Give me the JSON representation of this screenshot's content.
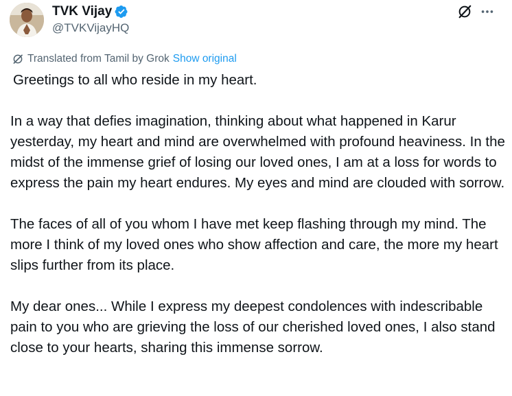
{
  "author": {
    "name": "TVK Vijay",
    "handle": "@TVKVijayHQ",
    "verified": true,
    "avatar_icon": "profile-photo",
    "verified_icon": "verified-badge-icon",
    "verified_color": "#1d9bf0"
  },
  "actions": {
    "grok_icon": "grok-icon",
    "more_icon": "more-horizontal-icon"
  },
  "translation": {
    "icon": "grok-translate-icon",
    "label": "Translated from Tamil by Grok",
    "show_original": "Show original",
    "link_color": "#1d9bf0"
  },
  "body": {
    "paragraphs": [
      "Greetings to all who reside in my heart.",
      "In a way that defies imagination, thinking about what happened in Karur yesterday, my heart and mind are overwhelmed with profound heaviness. In the midst of the immense grief of losing our loved ones, I am at a loss for words to express the pain my heart endures. My eyes and mind are clouded with sorrow.",
      "The faces of all of you whom I have met keep flashing through my mind. The more I think of my loved ones who show affection and care, the more my heart slips further from its place.",
      "My dear ones... While I express my deepest condolences with indescribable pain to you who are grieving the loss of our cherished loved ones, I also stand close to your hearts, sharing this immense sorrow."
    ]
  }
}
